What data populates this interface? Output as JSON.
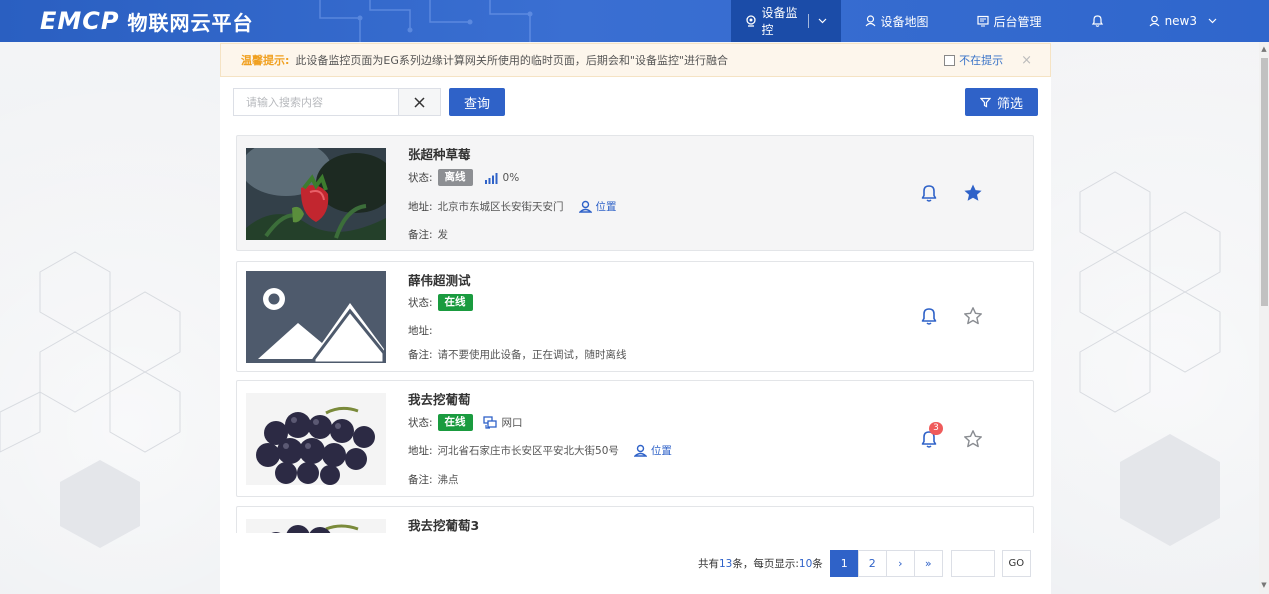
{
  "header": {
    "logo_brand": "EMCP",
    "logo_subtitle": "物联网云平台",
    "nav": [
      {
        "label": "设备监控",
        "active": true
      },
      {
        "label": "设备地图"
      },
      {
        "label": "后台管理"
      },
      {
        "label": ""
      },
      {
        "label": "new3"
      }
    ]
  },
  "notice": {
    "title": "温馨提示:",
    "text": "此设备监控页面为EG系列边缘计算网关所使用的临时页面，后期会和\"设备监控\"进行融合",
    "dont_show_label": "不在提示",
    "close_glyph": "×"
  },
  "search": {
    "placeholder": "请输入搜索内容",
    "value": "",
    "query_label": "查询",
    "filter_label": "筛选"
  },
  "devices": [
    {
      "name": "张超种草莓",
      "status_label": "状态:",
      "status": "离线",
      "signal": "0%",
      "address_label": "地址:",
      "address": "北京市东城区长安街天安门",
      "location_link": "位置",
      "remark_label": "备注:",
      "remark": "发",
      "alarm_count": "",
      "favorite": true
    },
    {
      "name": "薛伟超测试",
      "status_label": "状态:",
      "status": "在线",
      "address_label": "地址:",
      "address": "",
      "remark_label": "备注:",
      "remark": "请不要使用此设备，正在调试，随时离线",
      "alarm_count": "",
      "favorite": false
    },
    {
      "name": "我去挖葡萄",
      "status_label": "状态:",
      "status": "在线",
      "network": "网口",
      "address_label": "地址:",
      "address": "河北省石家庄市长安区平安北大街50号",
      "location_link": "位置",
      "remark_label": "备注:",
      "remark": "沸点",
      "alarm_count": "3",
      "favorite": false
    },
    {
      "name": "我去挖葡萄3"
    }
  ],
  "pagination": {
    "total_prefix": "共有",
    "total": "13",
    "total_suffix": "条，每页显示:",
    "per_page": "10",
    "per_page_suffix": "条",
    "pages": [
      "1",
      "2"
    ],
    "current": "1",
    "next": "›",
    "last": "»",
    "go_label": "GO"
  },
  "colors": {
    "primary": "#2f62c8",
    "online": "#1a9b3f",
    "offline": "#8d8f93",
    "badge": "#ef5b5b",
    "notice_title": "#f0a020"
  }
}
